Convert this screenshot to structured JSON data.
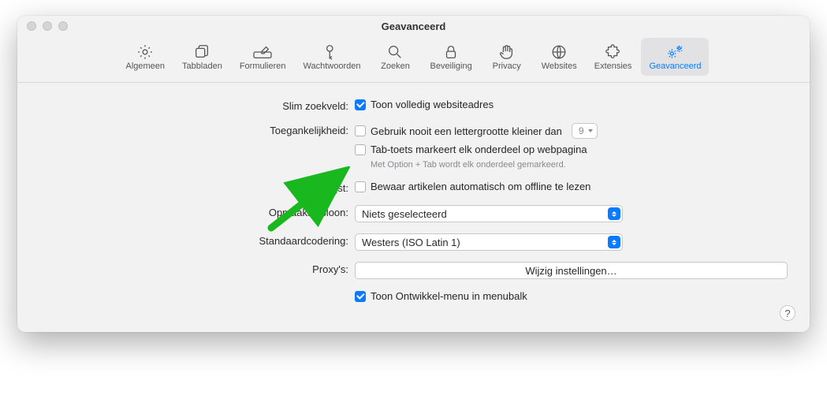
{
  "title": "Geavanceerd",
  "tabs": [
    {
      "label": "Algemeen"
    },
    {
      "label": "Tabbladen"
    },
    {
      "label": "Formulieren"
    },
    {
      "label": "Wachtwoorden"
    },
    {
      "label": "Zoeken"
    },
    {
      "label": "Beveiliging"
    },
    {
      "label": "Privacy"
    },
    {
      "label": "Websites"
    },
    {
      "label": "Extensies"
    },
    {
      "label": "Geavanceerd"
    }
  ],
  "rows": {
    "smartsearch": {
      "label": "Slim zoekveld:",
      "opt": "Toon volledig websiteadres"
    },
    "accessibility": {
      "label": "Toegankelijkheid:",
      "opt1": "Gebruik nooit een lettergrootte kleiner dan",
      "fontsize": "9",
      "opt2": "Tab-toets markeert elk onderdeel op webpagina",
      "helper": "Met Option + Tab wordt elk onderdeel gemarkeerd."
    },
    "readinglist": {
      "label": "Leeslijst:",
      "opt": "Bewaar artikelen automatisch om offline te lezen"
    },
    "stylesheet": {
      "label": "Opmaaksjabloon:",
      "value": "Niets geselecteerd"
    },
    "encoding": {
      "label": "Standaardcodering:",
      "value": "Westers (ISO Latin 1)"
    },
    "proxies": {
      "label": "Proxy's:",
      "button": "Wijzig instellingen…"
    },
    "develop": {
      "opt": "Toon Ontwikkel-menu in menubalk"
    }
  },
  "help": "?"
}
